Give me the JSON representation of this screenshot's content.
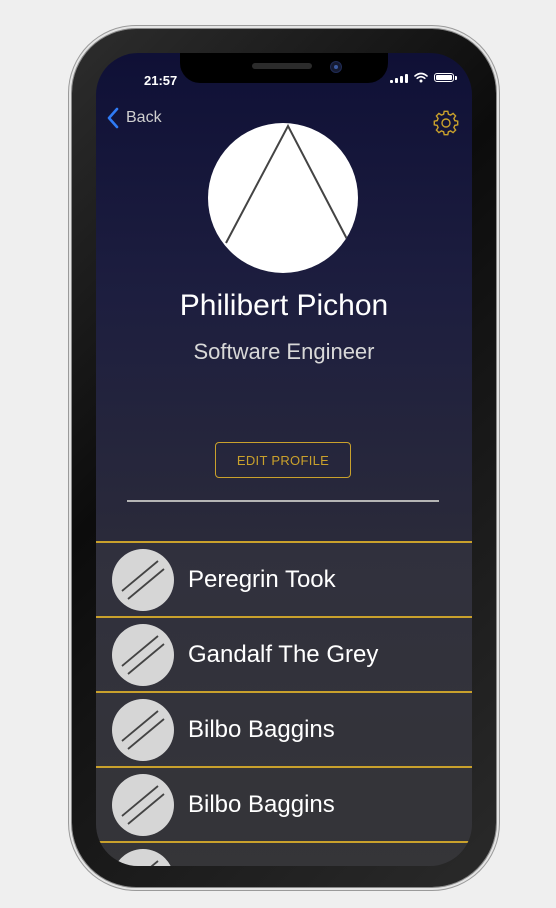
{
  "status_bar": {
    "time": "21:57"
  },
  "nav": {
    "back_label": "Back",
    "back_icon": "chevron-left-icon",
    "settings_icon": "gear-icon"
  },
  "profile": {
    "name": "Philibert Pichon",
    "role": "Software Engineer",
    "edit_label": "EDIT PROFILE"
  },
  "contacts": [
    {
      "name": "Peregrin Took"
    },
    {
      "name": "Gandalf The Grey"
    },
    {
      "name": "Bilbo Baggins"
    },
    {
      "name": "Bilbo Baggins"
    },
    {
      "name": ""
    }
  ],
  "colors": {
    "accent": "#c9a12c",
    "back_chevron": "#2f7bf5",
    "bg_top": "#0f1036",
    "bg_bottom": "#323232"
  }
}
